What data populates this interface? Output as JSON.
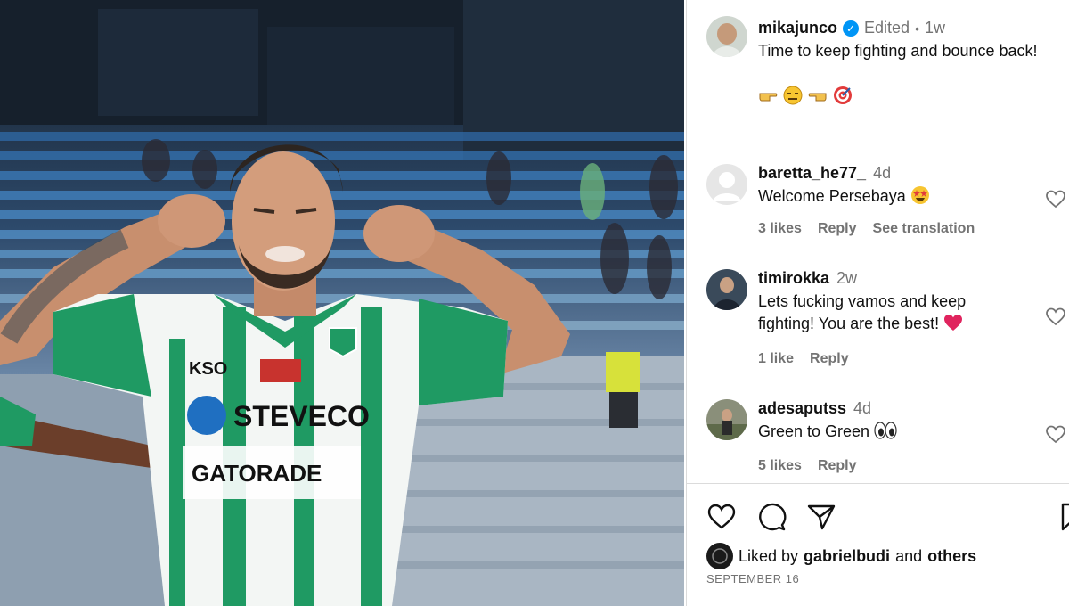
{
  "post": {
    "username": "mikajunco",
    "edited": "Edited",
    "separator": "•",
    "time": "1w",
    "caption": "Time to keep fighting and bounce back!",
    "caption_emojis": [
      "pointing-right-emoji",
      "expressionless-face-emoji",
      "pointing-left-emoji",
      "target-emoji"
    ]
  },
  "jersey": {
    "brand_a": "KSO",
    "brand_b": "STEVECO",
    "brand_c": "GATORADE"
  },
  "comments": [
    {
      "username": "baretta_he77_",
      "time": "4d",
      "text": "Welcome Persebaya",
      "emoji": "star-struck-emoji",
      "likes": "3 likes",
      "reply": "Reply",
      "translation": "See translation"
    },
    {
      "username": "timirokka",
      "time": "2w",
      "text": "Lets fucking vamos and keep fighting! You are the best!",
      "emoji": "red-heart-emoji",
      "likes": "1 like",
      "reply": "Reply"
    },
    {
      "username": "adesaputss",
      "time": "4d",
      "text": "Green to Green",
      "emoji": "eyes-emoji",
      "likes": "5 likes",
      "reply": "Reply"
    }
  ],
  "likes_summary": {
    "prefix": "Liked by",
    "user": "gabrielbudi",
    "joiner": "and",
    "others": "others"
  },
  "date": "SEPTEMBER 16",
  "colors": {
    "link_blue": "#0095f6",
    "muted_text": "#737373",
    "jersey_green": "#1f9a63",
    "heart_red": "#e0245e"
  }
}
